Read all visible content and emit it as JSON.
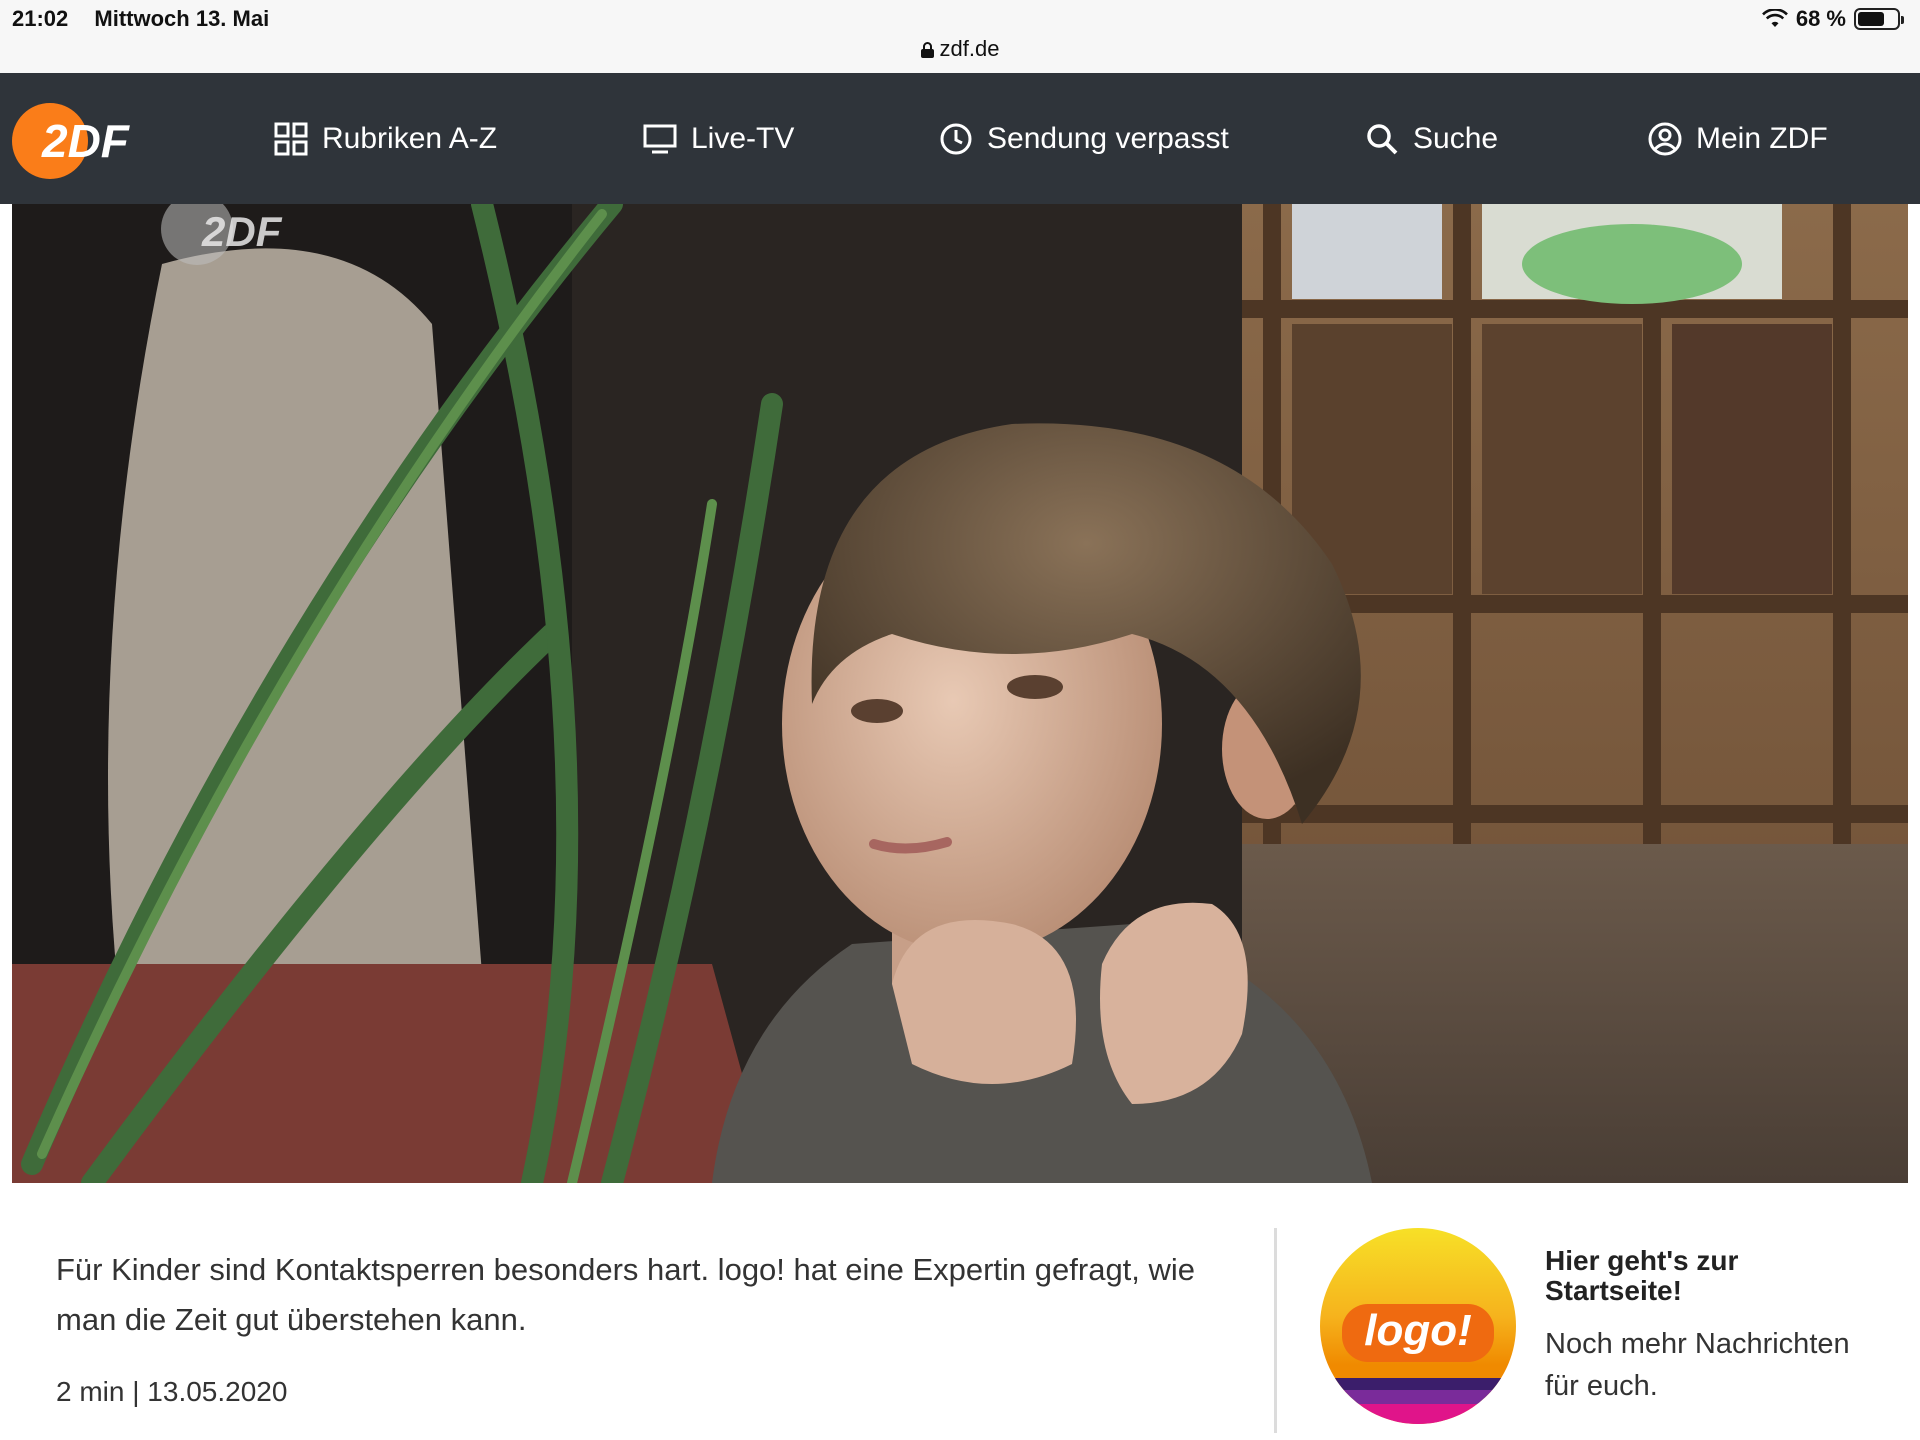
{
  "status_bar": {
    "time": "21:02",
    "date": "Mittwoch 13. Mai",
    "battery": "68 %",
    "battery_level": 0.68,
    "url": "zdf.de"
  },
  "nav": {
    "logo_text": "2DF",
    "items": [
      {
        "label": "Rubriken A-Z",
        "icon": "grid-icon"
      },
      {
        "label": "Live-TV",
        "icon": "tv-icon"
      },
      {
        "label": "Sendung verpasst",
        "icon": "clock-icon"
      },
      {
        "label": "Suche",
        "icon": "search-icon"
      },
      {
        "label": "Mein ZDF",
        "icon": "user-icon"
      }
    ]
  },
  "hero": {
    "watermark": "2DF",
    "image": "boy-resting-chin-on-hand"
  },
  "article": {
    "description": "Für Kinder sind Kontaktsperren besonders hart. logo! hat eine Expertin gefragt, wie man die Zeit gut überstehen kann.",
    "meta": "2 min | 13.05.2020"
  },
  "promo": {
    "logo_text": "logo!",
    "title": "Hier geht's zur Startseite!",
    "text": "Noch mehr Nachrichten für euch."
  },
  "colors": {
    "nav_bg": "#2f343a",
    "zdf_orange": "#fa7d19",
    "logo_yellow": "#f5d000",
    "logo_orange": "#f08a00",
    "logo_purple": "#5a1f8a",
    "logo_pink": "#e0148a"
  }
}
